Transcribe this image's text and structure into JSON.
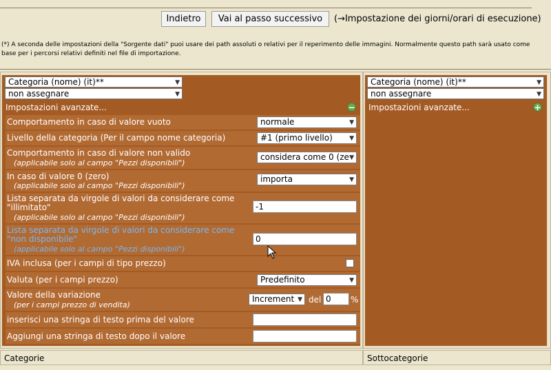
{
  "toolbar": {
    "back_label": "Indietro",
    "next_label": "Vai al passo successivo",
    "next_hint": "(→Impostazione dei giorni/orari di esecuzione)"
  },
  "note": "(*) A seconda delle impostazioni della \"Sorgente dati\" puoi usare dei path assoluti o relativi per il reperimento delle immagini. Normalmente questo path sarà usato come base per i percorsi relativi definiti nel file di importazione.",
  "left": {
    "field_select": "Categoria (nome) (it)**",
    "assign_select": "non assegnare",
    "advanced_label": "Impostazioni avanzate...",
    "advanced_icon": "minus-icon",
    "rows": {
      "empty_value": {
        "label": "Comportamento in caso di valore vuoto",
        "value": "normale"
      },
      "category_level": {
        "label": "Livello della categoria (Per il campo nome categoria)",
        "value": "#1 (primo livello)"
      },
      "invalid_value": {
        "label": "Comportamento in caso di valore non valido",
        "sub": "(applicabile solo al campo \"Pezzi disponibili\")",
        "value": "considera come 0 (ze"
      },
      "zero_value": {
        "label": "In caso di valore 0 (zero)",
        "sub": "(applicabile solo al campo \"Pezzi disponibili\")",
        "value": "importa"
      },
      "unlimited": {
        "label": "Lista separata da virgole di valori da considerare come \"illimitato\"",
        "sub": "(applicabile solo al campo \"Pezzi disponibili\")",
        "value": "-1"
      },
      "unavailable": {
        "label": "Lista separata da virgole di valori da considerare come \"non disponibile\"",
        "sub": "(applicabile solo al campo \"Pezzi disponibili\")",
        "value": "0"
      },
      "vat": {
        "label": "IVA inclusa (per i campi di tipo prezzo)"
      },
      "currency": {
        "label": "Valuta (per i campi prezzo)",
        "value": "Predefinito"
      },
      "variation": {
        "label": "Valore della variazione",
        "sub": "(per i campi prezzo di vendita)",
        "type_value": "Increment",
        "of_label": "del",
        "amount": "0",
        "unit": "%"
      },
      "prefix": {
        "label": "inserisci una stringa di testo prima del valore",
        "value": ""
      },
      "suffix": {
        "label": "Aggiungi una stringa di testo dopo il valore",
        "value": ""
      }
    },
    "footer": "Categorie"
  },
  "right": {
    "field_select": "Categoria (nome) (it)**",
    "assign_select": "non assegnare",
    "advanced_label": "Impostazioni avanzate...",
    "advanced_icon": "plus-icon",
    "footer": "Sottocategorie"
  },
  "colors": {
    "panel": "#a35a23",
    "row": "#b26a33",
    "highlight_text": "#78b8f0"
  }
}
